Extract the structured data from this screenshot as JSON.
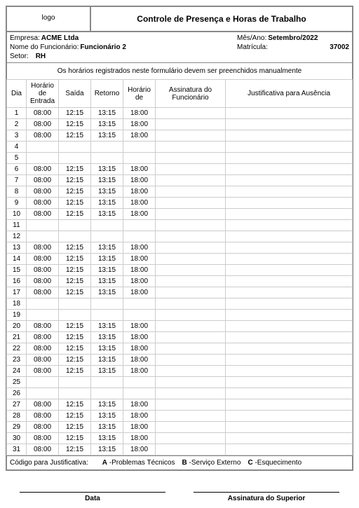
{
  "logo_placeholder": "logo",
  "title": "Controle de Presença e Horas de Trabalho",
  "info": {
    "empresa_label": "Empresa:",
    "empresa": "ACME Ltda",
    "mesano_label": "Mês/Ano:",
    "mesano": "Setembro/2022",
    "nome_label": "Nome do Funcionário:",
    "nome": "Funcionário 2",
    "matricula_label": "Matrícula:",
    "matricula": "37002",
    "setor_label": "Setor:",
    "setor": "RH"
  },
  "note": "Os horários registrados neste formulário devem ser preenchidos manualmente",
  "columns": {
    "dia": "Dia",
    "entrada": "Horário de Entrada",
    "saida": "Saída",
    "retorno": "Retorno",
    "horario_de": "Horário de",
    "assinatura": "Assinatura do Funcionário",
    "justificativa": "Justificativa para Ausência"
  },
  "rows": [
    {
      "dia": "1",
      "entrada": "08:00",
      "saida": "12:15",
      "retorno": "13:15",
      "fim": "18:00"
    },
    {
      "dia": "2",
      "entrada": "08:00",
      "saida": "12:15",
      "retorno": "13:15",
      "fim": "18:00"
    },
    {
      "dia": "3",
      "entrada": "08:00",
      "saida": "12:15",
      "retorno": "13:15",
      "fim": "18:00"
    },
    {
      "dia": "4",
      "entrada": "",
      "saida": "",
      "retorno": "",
      "fim": ""
    },
    {
      "dia": "5",
      "entrada": "",
      "saida": "",
      "retorno": "",
      "fim": ""
    },
    {
      "dia": "6",
      "entrada": "08:00",
      "saida": "12:15",
      "retorno": "13:15",
      "fim": "18:00"
    },
    {
      "dia": "7",
      "entrada": "08:00",
      "saida": "12:15",
      "retorno": "13:15",
      "fim": "18:00"
    },
    {
      "dia": "8",
      "entrada": "08:00",
      "saida": "12:15",
      "retorno": "13:15",
      "fim": "18:00"
    },
    {
      "dia": "9",
      "entrada": "08:00",
      "saida": "12:15",
      "retorno": "13:15",
      "fim": "18:00"
    },
    {
      "dia": "10",
      "entrada": "08:00",
      "saida": "12:15",
      "retorno": "13:15",
      "fim": "18:00"
    },
    {
      "dia": "11",
      "entrada": "",
      "saida": "",
      "retorno": "",
      "fim": ""
    },
    {
      "dia": "12",
      "entrada": "",
      "saida": "",
      "retorno": "",
      "fim": ""
    },
    {
      "dia": "13",
      "entrada": "08:00",
      "saida": "12:15",
      "retorno": "13:15",
      "fim": "18:00"
    },
    {
      "dia": "14",
      "entrada": "08:00",
      "saida": "12:15",
      "retorno": "13:15",
      "fim": "18:00"
    },
    {
      "dia": "15",
      "entrada": "08:00",
      "saida": "12:15",
      "retorno": "13:15",
      "fim": "18:00"
    },
    {
      "dia": "16",
      "entrada": "08:00",
      "saida": "12:15",
      "retorno": "13:15",
      "fim": "18:00"
    },
    {
      "dia": "17",
      "entrada": "08:00",
      "saida": "12:15",
      "retorno": "13:15",
      "fim": "18:00"
    },
    {
      "dia": "18",
      "entrada": "",
      "saida": "",
      "retorno": "",
      "fim": ""
    },
    {
      "dia": "19",
      "entrada": "",
      "saida": "",
      "retorno": "",
      "fim": ""
    },
    {
      "dia": "20",
      "entrada": "08:00",
      "saida": "12:15",
      "retorno": "13:15",
      "fim": "18:00"
    },
    {
      "dia": "21",
      "entrada": "08:00",
      "saida": "12:15",
      "retorno": "13:15",
      "fim": "18:00"
    },
    {
      "dia": "22",
      "entrada": "08:00",
      "saida": "12:15",
      "retorno": "13:15",
      "fim": "18:00"
    },
    {
      "dia": "23",
      "entrada": "08:00",
      "saida": "12:15",
      "retorno": "13:15",
      "fim": "18:00"
    },
    {
      "dia": "24",
      "entrada": "08:00",
      "saida": "12:15",
      "retorno": "13:15",
      "fim": "18:00"
    },
    {
      "dia": "25",
      "entrada": "",
      "saida": "",
      "retorno": "",
      "fim": ""
    },
    {
      "dia": "26",
      "entrada": "",
      "saida": "",
      "retorno": "",
      "fim": ""
    },
    {
      "dia": "27",
      "entrada": "08:00",
      "saida": "12:15",
      "retorno": "13:15",
      "fim": "18:00"
    },
    {
      "dia": "28",
      "entrada": "08:00",
      "saida": "12:15",
      "retorno": "13:15",
      "fim": "18:00"
    },
    {
      "dia": "29",
      "entrada": "08:00",
      "saida": "12:15",
      "retorno": "13:15",
      "fim": "18:00"
    },
    {
      "dia": "30",
      "entrada": "08:00",
      "saida": "12:15",
      "retorno": "13:15",
      "fim": "18:00"
    },
    {
      "dia": "31",
      "entrada": "08:00",
      "saida": "12:15",
      "retorno": "13:15",
      "fim": "18:00"
    }
  ],
  "codes_label": "Código para Justificativa:",
  "codes": [
    {
      "k": "A",
      "v": "-Problemas Técnicos"
    },
    {
      "k": "B",
      "v": "-Serviço Externo"
    },
    {
      "k": "C",
      "v": "-Esquecimento"
    }
  ],
  "sig_date": "Data",
  "sig_superior": "Assinatura do Superior"
}
